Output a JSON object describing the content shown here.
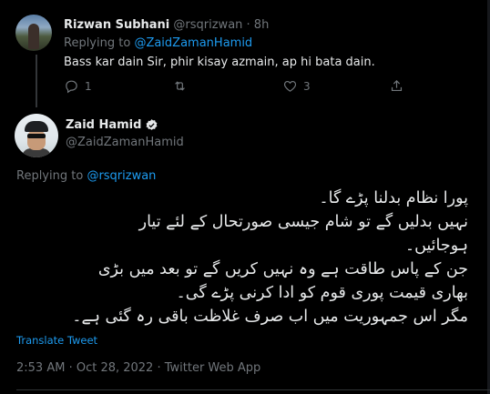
{
  "reply": {
    "name": "Rizwan Subhani",
    "handle": "@rsqrizwan",
    "time": "· 8h",
    "replying_prefix": "Replying to ",
    "replying_handle": "@ZaidZamanHamid",
    "text": "Bass kar dain Sir, phir kisay azmain, ap hi bata dain.",
    "reply_count": "1",
    "retweet_count": "",
    "like_count": "3"
  },
  "main": {
    "name": "Zaid Hamid",
    "handle": "@ZaidZamanHamid",
    "replying_prefix": "Replying to ",
    "replying_handle": "@rsqrizwan",
    "lines": [
      "پورا نظام بدلنا پڑے گا۔",
      "نہیں بدلیں گے تو شام جیسی صورتحال کے لئے تیار",
      "ہوجائیں۔",
      "جن کے پاس طاقت ہے وہ نہیں کریں گے تو بعد میں بڑی",
      "بھاری قیمت پوری قوم کو ادا کرنی پڑے گی۔",
      "مگر اس جمہوریت میں اب صرف غلاظت باقی رہ گئی ہے۔"
    ],
    "translate_label": "Translate Tweet",
    "meta": "2:53 AM · Oct 28, 2022 · Twitter Web App"
  },
  "colors": {
    "background": "#000000",
    "text": "#e7e9ea",
    "muted": "#71767b",
    "link": "#1d9bf0"
  }
}
